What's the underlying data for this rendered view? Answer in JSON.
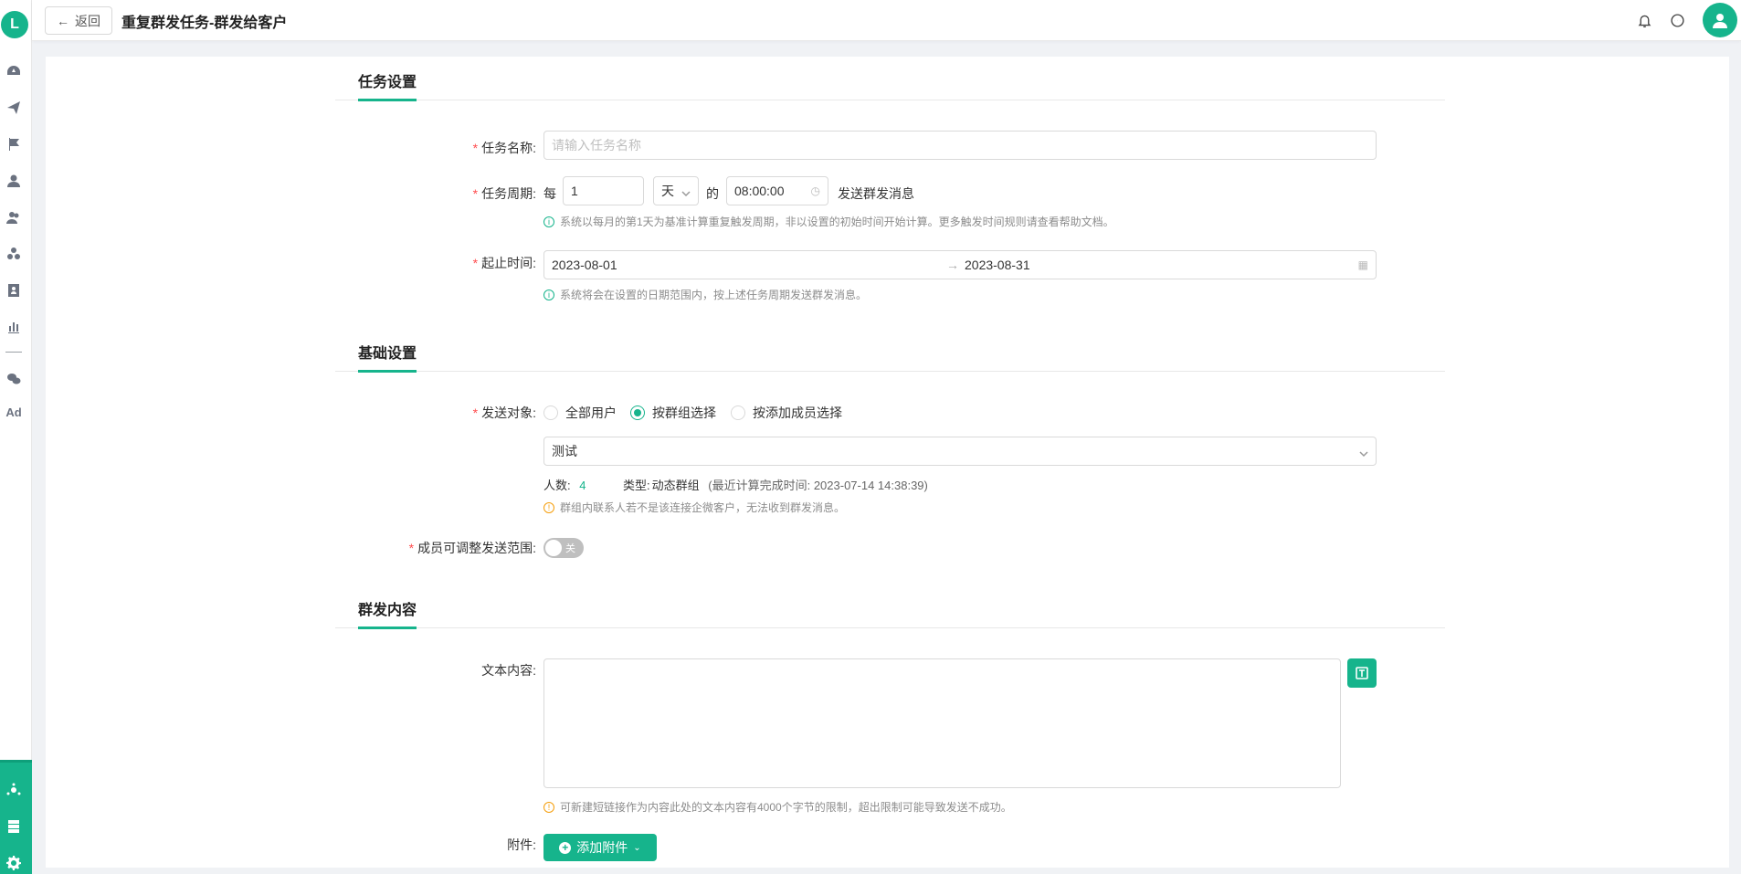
{
  "app": {
    "logo_text": "L"
  },
  "header": {
    "back_label": "返回",
    "title": "重复群发任务-群发给客户"
  },
  "sidebar": {
    "icons": [
      "dashboard-icon",
      "send-icon",
      "flag-icon",
      "user-icon",
      "users-icon",
      "cluster-icon",
      "contact-card-icon",
      "bar-chart-icon",
      "wechat-icon"
    ],
    "ad_label": "Ad",
    "bottom_icons": [
      "network-icon",
      "server-icon",
      "settings-icon"
    ]
  },
  "task_settings": {
    "section_title": "任务设置",
    "name_label": "任务名称:",
    "name_placeholder": "请输入任务名称",
    "period_label": "任务周期:",
    "period_every": "每",
    "period_count": "1",
    "period_unit": "天",
    "period_of": "的",
    "period_time": "08:00:00",
    "period_suffix": "发送群发消息",
    "period_hint": "系统以每月的第1天为基准计算重复触发周期，非以设置的初始时间开始计算。更多触发时间规则请查看帮助文档。",
    "range_label": "起止时间:",
    "range_start": "2023-08-01",
    "range_end": "2023-08-31",
    "range_hint": "系统将会在设置的日期范围内，按上述任务周期发送群发消息。"
  },
  "basic_settings": {
    "section_title": "基础设置",
    "target_label": "发送对象:",
    "target_options": [
      "全部用户",
      "按群组选择",
      "按添加成员选择"
    ],
    "target_selected": 1,
    "group_value": "测试",
    "count_label": "人数:",
    "count_value": "4",
    "type_label": "类型:",
    "type_value": "动态群组",
    "last_calc": "(最近计算完成时间: 2023-07-14 14:38:39)",
    "group_hint": "群组内联系人若不是该连接企微客户，无法收到群发消息。",
    "adjust_label": "成员可调整发送范围:",
    "adjust_toggle_text": "关"
  },
  "content": {
    "section_title": "群发内容",
    "text_label": "文本内容:",
    "text_hint": "可新建短链接作为内容此处的文本内容有4000个字节的限制，超出限制可能导致发送不成功。",
    "attach_label": "附件:",
    "attach_button": "添加附件"
  },
  "colors": {
    "accent": "#16b48c",
    "required": "#ff4d4f",
    "warning": "#f59e0b"
  }
}
